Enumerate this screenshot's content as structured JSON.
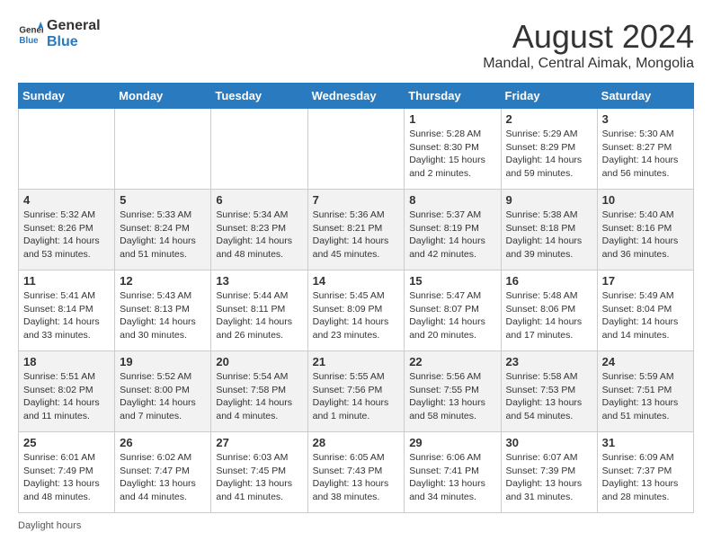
{
  "logo": {
    "general": "General",
    "blue": "Blue"
  },
  "title": "August 2024",
  "subtitle": "Mandal, Central Aimak, Mongolia",
  "days_header": [
    "Sunday",
    "Monday",
    "Tuesday",
    "Wednesday",
    "Thursday",
    "Friday",
    "Saturday"
  ],
  "footer_label": "Daylight hours",
  "weeks": [
    [
      {
        "day": "",
        "sunrise": "",
        "sunset": "",
        "daylight": ""
      },
      {
        "day": "",
        "sunrise": "",
        "sunset": "",
        "daylight": ""
      },
      {
        "day": "",
        "sunrise": "",
        "sunset": "",
        "daylight": ""
      },
      {
        "day": "",
        "sunrise": "",
        "sunset": "",
        "daylight": ""
      },
      {
        "day": "1",
        "sunrise": "Sunrise: 5:28 AM",
        "sunset": "Sunset: 8:30 PM",
        "daylight": "Daylight: 15 hours and 2 minutes."
      },
      {
        "day": "2",
        "sunrise": "Sunrise: 5:29 AM",
        "sunset": "Sunset: 8:29 PM",
        "daylight": "Daylight: 14 hours and 59 minutes."
      },
      {
        "day": "3",
        "sunrise": "Sunrise: 5:30 AM",
        "sunset": "Sunset: 8:27 PM",
        "daylight": "Daylight: 14 hours and 56 minutes."
      }
    ],
    [
      {
        "day": "4",
        "sunrise": "Sunrise: 5:32 AM",
        "sunset": "Sunset: 8:26 PM",
        "daylight": "Daylight: 14 hours and 53 minutes."
      },
      {
        "day": "5",
        "sunrise": "Sunrise: 5:33 AM",
        "sunset": "Sunset: 8:24 PM",
        "daylight": "Daylight: 14 hours and 51 minutes."
      },
      {
        "day": "6",
        "sunrise": "Sunrise: 5:34 AM",
        "sunset": "Sunset: 8:23 PM",
        "daylight": "Daylight: 14 hours and 48 minutes."
      },
      {
        "day": "7",
        "sunrise": "Sunrise: 5:36 AM",
        "sunset": "Sunset: 8:21 PM",
        "daylight": "Daylight: 14 hours and 45 minutes."
      },
      {
        "day": "8",
        "sunrise": "Sunrise: 5:37 AM",
        "sunset": "Sunset: 8:19 PM",
        "daylight": "Daylight: 14 hours and 42 minutes."
      },
      {
        "day": "9",
        "sunrise": "Sunrise: 5:38 AM",
        "sunset": "Sunset: 8:18 PM",
        "daylight": "Daylight: 14 hours and 39 minutes."
      },
      {
        "day": "10",
        "sunrise": "Sunrise: 5:40 AM",
        "sunset": "Sunset: 8:16 PM",
        "daylight": "Daylight: 14 hours and 36 minutes."
      }
    ],
    [
      {
        "day": "11",
        "sunrise": "Sunrise: 5:41 AM",
        "sunset": "Sunset: 8:14 PM",
        "daylight": "Daylight: 14 hours and 33 minutes."
      },
      {
        "day": "12",
        "sunrise": "Sunrise: 5:43 AM",
        "sunset": "Sunset: 8:13 PM",
        "daylight": "Daylight: 14 hours and 30 minutes."
      },
      {
        "day": "13",
        "sunrise": "Sunrise: 5:44 AM",
        "sunset": "Sunset: 8:11 PM",
        "daylight": "Daylight: 14 hours and 26 minutes."
      },
      {
        "day": "14",
        "sunrise": "Sunrise: 5:45 AM",
        "sunset": "Sunset: 8:09 PM",
        "daylight": "Daylight: 14 hours and 23 minutes."
      },
      {
        "day": "15",
        "sunrise": "Sunrise: 5:47 AM",
        "sunset": "Sunset: 8:07 PM",
        "daylight": "Daylight: 14 hours and 20 minutes."
      },
      {
        "day": "16",
        "sunrise": "Sunrise: 5:48 AM",
        "sunset": "Sunset: 8:06 PM",
        "daylight": "Daylight: 14 hours and 17 minutes."
      },
      {
        "day": "17",
        "sunrise": "Sunrise: 5:49 AM",
        "sunset": "Sunset: 8:04 PM",
        "daylight": "Daylight: 14 hours and 14 minutes."
      }
    ],
    [
      {
        "day": "18",
        "sunrise": "Sunrise: 5:51 AM",
        "sunset": "Sunset: 8:02 PM",
        "daylight": "Daylight: 14 hours and 11 minutes."
      },
      {
        "day": "19",
        "sunrise": "Sunrise: 5:52 AM",
        "sunset": "Sunset: 8:00 PM",
        "daylight": "Daylight: 14 hours and 7 minutes."
      },
      {
        "day": "20",
        "sunrise": "Sunrise: 5:54 AM",
        "sunset": "Sunset: 7:58 PM",
        "daylight": "Daylight: 14 hours and 4 minutes."
      },
      {
        "day": "21",
        "sunrise": "Sunrise: 5:55 AM",
        "sunset": "Sunset: 7:56 PM",
        "daylight": "Daylight: 14 hours and 1 minute."
      },
      {
        "day": "22",
        "sunrise": "Sunrise: 5:56 AM",
        "sunset": "Sunset: 7:55 PM",
        "daylight": "Daylight: 13 hours and 58 minutes."
      },
      {
        "day": "23",
        "sunrise": "Sunrise: 5:58 AM",
        "sunset": "Sunset: 7:53 PM",
        "daylight": "Daylight: 13 hours and 54 minutes."
      },
      {
        "day": "24",
        "sunrise": "Sunrise: 5:59 AM",
        "sunset": "Sunset: 7:51 PM",
        "daylight": "Daylight: 13 hours and 51 minutes."
      }
    ],
    [
      {
        "day": "25",
        "sunrise": "Sunrise: 6:01 AM",
        "sunset": "Sunset: 7:49 PM",
        "daylight": "Daylight: 13 hours and 48 minutes."
      },
      {
        "day": "26",
        "sunrise": "Sunrise: 6:02 AM",
        "sunset": "Sunset: 7:47 PM",
        "daylight": "Daylight: 13 hours and 44 minutes."
      },
      {
        "day": "27",
        "sunrise": "Sunrise: 6:03 AM",
        "sunset": "Sunset: 7:45 PM",
        "daylight": "Daylight: 13 hours and 41 minutes."
      },
      {
        "day": "28",
        "sunrise": "Sunrise: 6:05 AM",
        "sunset": "Sunset: 7:43 PM",
        "daylight": "Daylight: 13 hours and 38 minutes."
      },
      {
        "day": "29",
        "sunrise": "Sunrise: 6:06 AM",
        "sunset": "Sunset: 7:41 PM",
        "daylight": "Daylight: 13 hours and 34 minutes."
      },
      {
        "day": "30",
        "sunrise": "Sunrise: 6:07 AM",
        "sunset": "Sunset: 7:39 PM",
        "daylight": "Daylight: 13 hours and 31 minutes."
      },
      {
        "day": "31",
        "sunrise": "Sunrise: 6:09 AM",
        "sunset": "Sunset: 7:37 PM",
        "daylight": "Daylight: 13 hours and 28 minutes."
      }
    ]
  ]
}
